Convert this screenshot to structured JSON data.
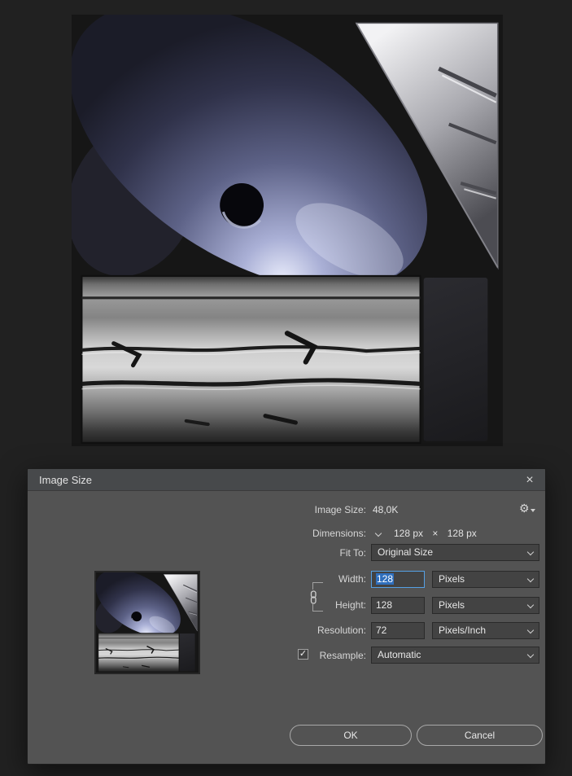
{
  "colors": {
    "dialog_bg": "#535353",
    "titlebar_bg": "#47494b",
    "focus_blue": "#55a0e4",
    "selection_blue": "#2f6fbd"
  },
  "icons": {
    "close": "×",
    "gear": "⚙",
    "check": "✓",
    "times": "×"
  },
  "dialog": {
    "title": "Image Size",
    "rows": {
      "image_size": {
        "label": "Image Size:",
        "value": "48,0K"
      },
      "dimensions": {
        "label": "Dimensions:",
        "value_w": "128 px",
        "times": "×",
        "value_h": "128 px"
      },
      "fit_to": {
        "label": "Fit To:",
        "value": "Original Size"
      },
      "width": {
        "label": "Width:",
        "value": "128",
        "unit": "Pixels"
      },
      "height": {
        "label": "Height:",
        "value": "128",
        "unit": "Pixels"
      },
      "resolution": {
        "label": "Resolution:",
        "value": "72",
        "unit": "Pixels/Inch"
      },
      "resample": {
        "label": "Resample:",
        "value": "Automatic"
      }
    },
    "buttons": {
      "ok": "OK",
      "cancel": "Cancel"
    }
  }
}
